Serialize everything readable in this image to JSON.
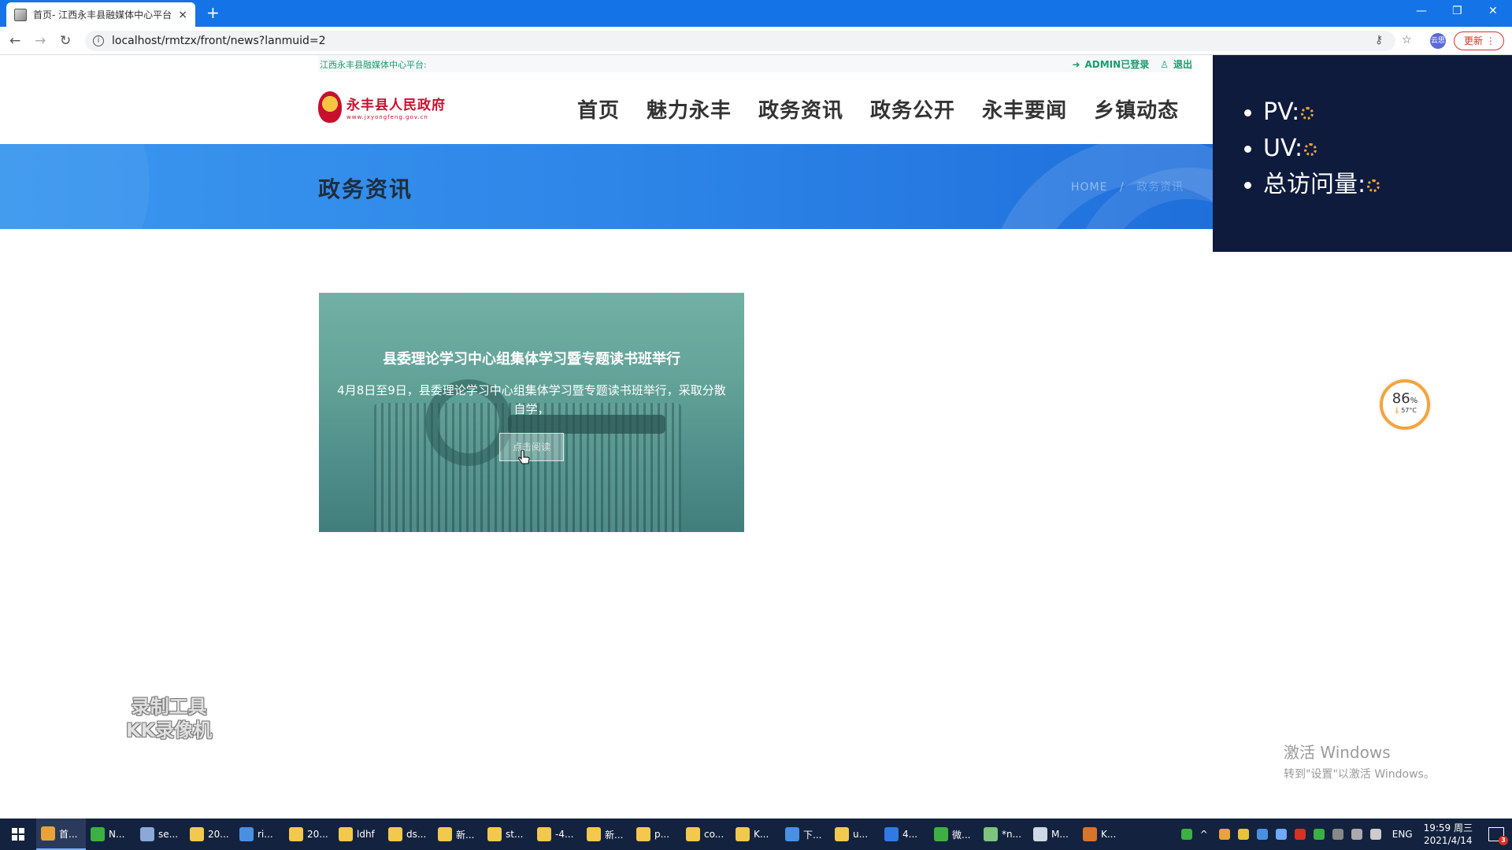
{
  "browser": {
    "tab_title": "首页- 江西永丰县融媒体中心平台",
    "tab_close": "×",
    "new_tab": "+",
    "url": "localhost/rmtzx/front/news?lanmuid=2",
    "update_label": "更新",
    "profile_label": "云思"
  },
  "topbar": {
    "platform_text": "江西永丰县融媒体中心平台:",
    "login_status": "ADMIN已登录",
    "logout_label": "退出"
  },
  "logo": {
    "name": "永丰县人民政府",
    "subtitle": "www.jxyongfeng.gov.cn"
  },
  "nav": {
    "items": [
      "首页",
      "魅力永丰",
      "政务资讯",
      "政务公开",
      "永丰要闻",
      "乡镇动态"
    ]
  },
  "banner": {
    "title": "政务资讯",
    "breadcrumb_home": "HOME",
    "breadcrumb_sep": "/",
    "breadcrumb_current": "政务资讯"
  },
  "news": [
    {
      "title": "县委理论学习中心组集体学习暨专题读书班举行",
      "summary": "4月8日至9日，县委理论学习中心组集体学习暨专题读书班举行，采取分散自学，",
      "button_label": "点击阅读"
    }
  ],
  "stats": {
    "pv_label": "PV:",
    "uv_label": "UV:",
    "total_label": "总访问量:"
  },
  "cpu_widget": {
    "percent": "86",
    "percent_unit": "%",
    "temperature": "57°C",
    "ring_color": "#f3a43c"
  },
  "watermark": {
    "line1": "录制工具",
    "line2": "KK录像机"
  },
  "activation": {
    "line1": "激活 Windows",
    "line2": "转到\"设置\"以激活 Windows。"
  },
  "taskbar": {
    "items": [
      {
        "label": "首...",
        "icon": "chrome-icon",
        "color": "#e8a33a"
      },
      {
        "label": "N...",
        "icon": "app-icon",
        "color": "#3cb043"
      },
      {
        "label": "se...",
        "icon": "app-icon",
        "color": "#8aa8d8"
      },
      {
        "label": "20...",
        "icon": "folder-icon",
        "color": "#f2c94c"
      },
      {
        "label": "ri...",
        "icon": "app-icon",
        "color": "#4a90e2"
      },
      {
        "label": "20...",
        "icon": "folder-icon",
        "color": "#f2c94c"
      },
      {
        "label": "ldhf",
        "icon": "folder-icon",
        "color": "#f2c94c"
      },
      {
        "label": "ds...",
        "icon": "folder-icon",
        "color": "#f2c94c"
      },
      {
        "label": "新...",
        "icon": "folder-icon",
        "color": "#f2c94c"
      },
      {
        "label": "st...",
        "icon": "folder-icon",
        "color": "#f2c94c"
      },
      {
        "label": "-4...",
        "icon": "folder-icon",
        "color": "#f2c94c"
      },
      {
        "label": "新...",
        "icon": "folder-icon",
        "color": "#f2c94c"
      },
      {
        "label": "p...",
        "icon": "folder-icon",
        "color": "#f2c94c"
      },
      {
        "label": "co...",
        "icon": "folder-icon",
        "color": "#f2c94c"
      },
      {
        "label": "K...",
        "icon": "folder-icon",
        "color": "#f2c94c"
      },
      {
        "label": "下...",
        "icon": "download-icon",
        "color": "#4a90e2"
      },
      {
        "label": "u...",
        "icon": "folder-icon",
        "color": "#f2c94c"
      },
      {
        "label": "4...",
        "icon": "vs-icon",
        "color": "#2f7ae5"
      },
      {
        "label": "微...",
        "icon": "wechat-icon",
        "color": "#3cb043"
      },
      {
        "label": "*n...",
        "icon": "notepad-icon",
        "color": "#7cc47f"
      },
      {
        "label": "M...",
        "icon": "pen-icon",
        "color": "#cfd8e6"
      },
      {
        "label": "K...",
        "icon": "recorder-icon",
        "color": "#d9742b"
      }
    ],
    "lang": "ENG",
    "time": "19:59 周三",
    "date": "2021/4/14",
    "notif_count": "3"
  }
}
